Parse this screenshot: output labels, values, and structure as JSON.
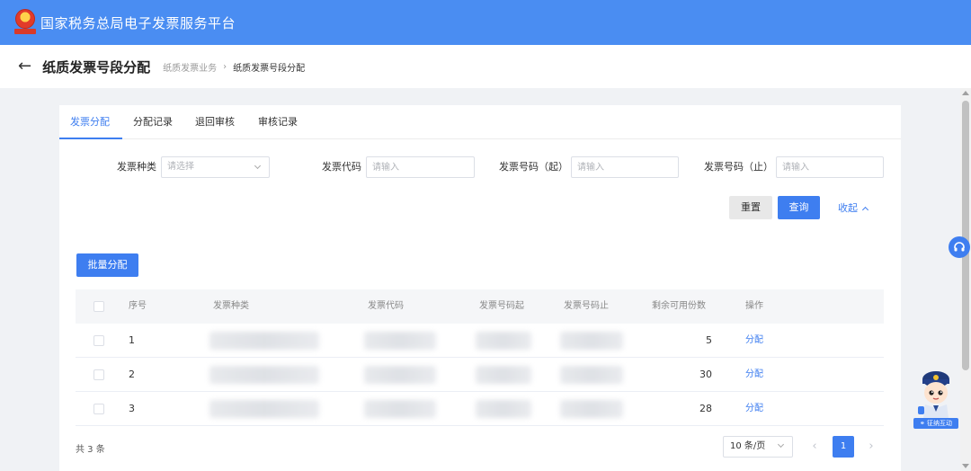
{
  "header": {
    "title": "国家税务总局电子发票服务平台"
  },
  "breadcrumb": {
    "page_title": "纸质发票号段分配",
    "items": [
      "纸质发票业务",
      "纸质发票号段分配"
    ]
  },
  "tabs": [
    {
      "label": "发票分配",
      "active": true
    },
    {
      "label": "分配记录",
      "active": false
    },
    {
      "label": "退回审核",
      "active": false
    },
    {
      "label": "审核记录",
      "active": false
    }
  ],
  "filters": {
    "invoice_type": {
      "label": "发票种类",
      "placeholder": "请选择"
    },
    "invoice_code": {
      "label": "发票代码",
      "placeholder": "请输入"
    },
    "number_start": {
      "label": "发票号码（起）",
      "placeholder": "请输入"
    },
    "number_end": {
      "label": "发票号码（止）",
      "placeholder": "请输入"
    }
  },
  "actions": {
    "reset": "重置",
    "query": "查询",
    "collapse": "收起",
    "batch_assign": "批量分配"
  },
  "table": {
    "columns": [
      "序号",
      "发票种类",
      "发票代码",
      "发票号码起",
      "发票号码止",
      "剩余可用份数",
      "操作"
    ],
    "rows": [
      {
        "index": "1",
        "remaining": "5",
        "action": "分配"
      },
      {
        "index": "2",
        "remaining": "30",
        "action": "分配"
      },
      {
        "index": "3",
        "remaining": "28",
        "action": "分配"
      }
    ]
  },
  "pagination": {
    "total": "共 3 条",
    "page_size": "10 条/页",
    "current_page": "1"
  },
  "widgets": {
    "assistant_label": "征纳互动"
  },
  "colors": {
    "brand_blue": "#4a8df2",
    "primary": "#3e7ef0"
  }
}
